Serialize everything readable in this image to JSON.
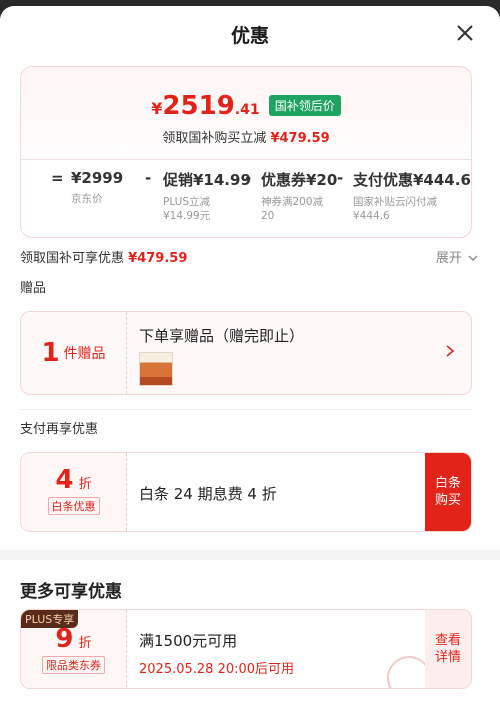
{
  "header": {
    "title": "优惠"
  },
  "price_card": {
    "currency": "¥",
    "final_int": "2519",
    "final_dec": ".41",
    "tag": "国补领后价",
    "sub_text": "领取国补购买立减",
    "sub_amount": "¥479.59",
    "formula": [
      {
        "op": "=",
        "value": "¥2999",
        "desc1": "京东价",
        "desc2": ""
      },
      {
        "op": "-",
        "value": "促销¥14.99",
        "desc1": "PLUS立减",
        "desc2": "¥14.99元"
      },
      {
        "op": "-",
        "value": "优惠券¥20",
        "desc1": "神券满200减",
        "desc2": "20"
      },
      {
        "op": "-",
        "value": "支付优惠¥444.6",
        "desc1": "国家补贴云闪付减",
        "desc2": "¥444.6"
      }
    ]
  },
  "subsidy_row": {
    "label": "领取国补可享优惠",
    "amount": "¥479.59",
    "expand": "展开"
  },
  "gift_section": {
    "label": "赠品",
    "count": "1",
    "unit": "件赠品",
    "title": "下单享赠品（赠完即止）"
  },
  "pay_section": {
    "label": "支付再享优惠",
    "discount": "4",
    "unit": "折",
    "badge": "白条优惠",
    "text": "白条 24 期息费 4 折",
    "button_line1": "白条",
    "button_line2": "购买"
  },
  "more_section": {
    "title": "更多可享优惠",
    "plus_tag": "PLUS专享",
    "discount": "9",
    "unit": "折",
    "badge": "限品类东券",
    "main": "满1500元可用",
    "sub": "2025.05.28 20:00后可用",
    "button_line1": "查看",
    "button_line2": "详情"
  },
  "colors": {
    "accent": "#e2231a",
    "green": "#1fa362"
  }
}
